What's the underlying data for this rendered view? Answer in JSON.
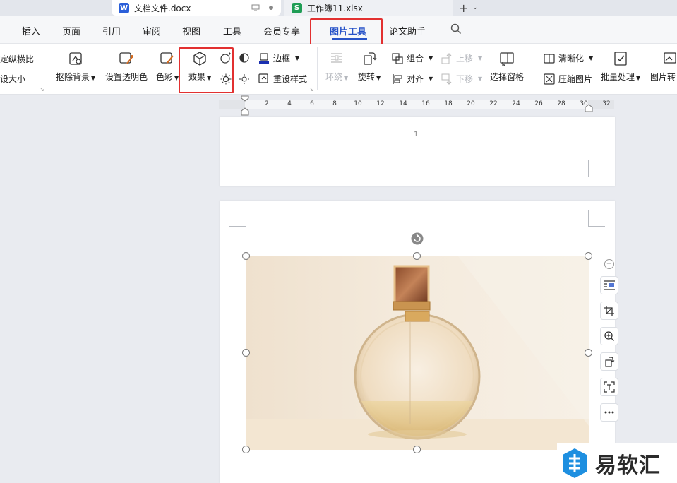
{
  "tabs": [
    {
      "label": "文档文件.docx",
      "badge": "W",
      "active": true
    },
    {
      "label": "工作簿11.xlsx",
      "badge": "S",
      "active": false
    }
  ],
  "menu": {
    "items": [
      "插入",
      "页面",
      "引用",
      "审阅",
      "视图",
      "工具",
      "会员专享",
      "图片工具",
      "论文助手"
    ],
    "active": "图片工具"
  },
  "ribbon": {
    "lock_ratio": "定纵横比",
    "reset_size": "设大小",
    "remove_bg": "抠除背景",
    "set_transparent": "设置透明色",
    "color": "色彩",
    "effects": "效果",
    "border": "边框",
    "reset_style": "重设样式",
    "wrap": "环绕",
    "rotate": "旋转",
    "group": "组合",
    "align": "对齐",
    "bring_forward": "上移",
    "send_backward": "下移",
    "selection_pane": "选择窗格",
    "sharpen": "清晰化",
    "compress": "压缩图片",
    "batch": "批量处理",
    "image_convert": "图片转"
  },
  "ruler": {
    "labels": [
      "2",
      "4",
      "6",
      "8",
      "10",
      "12",
      "14",
      "16",
      "18",
      "20",
      "22",
      "24",
      "26",
      "28",
      "30",
      "32"
    ]
  },
  "page": {
    "number": "1"
  },
  "watermark": {
    "text": "易软汇"
  },
  "colors": {
    "accent": "#2753c8",
    "highlight": "#e23030",
    "word_blue": "#2b5fd9",
    "sheet_green": "#1f9d55"
  }
}
